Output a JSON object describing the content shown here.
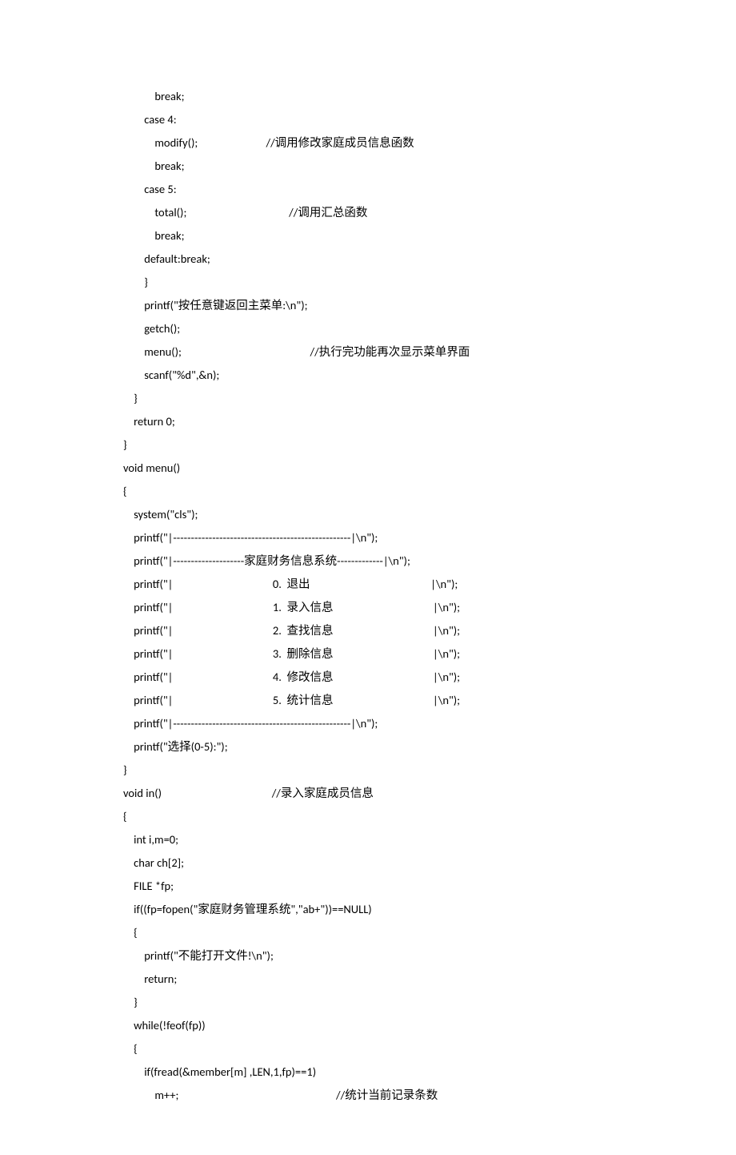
{
  "lines": [
    "            break;",
    "        case 4:",
    "            modify();                          //调用修改家庭成员信息函数",
    "            break;",
    "        case 5:",
    "            total();                                       //调用汇总函数",
    "            break;",
    "        default:break;",
    "        }",
    "        printf(\"按任意键返回主菜单:\\n\");",
    "        getch();",
    "        menu();                                                 //执行完功能再次显示菜单界面",
    "        scanf(\"%d\",&n);",
    "    }",
    "    return 0;",
    "}",
    "void menu()",
    "{",
    "    system(\"cls\");",
    "    printf(\"|--------------------------------------------------|\\n\");",
    "    printf(\"|--------------------家庭财务信息系统-------------|\\n\");",
    "    printf(\"|                                      0.  退出                                              |\\n\");",
    "    printf(\"|                                      1.  录入信息                                      |\\n\");",
    "    printf(\"|                                      2.  查找信息                                      |\\n\");",
    "    printf(\"|                                      3.  删除信息                                      |\\n\");",
    "    printf(\"|                                      4.  修改信息                                      |\\n\");",
    "    printf(\"|                                      5.  统计信息                                      |\\n\");",
    "    printf(\"|--------------------------------------------------|\\n\");",
    "    printf(\"选择(0-5):\");",
    "}",
    "void in()                                          //录入家庭成员信息",
    "{",
    "    int i,m=0;",
    "    char ch[2];",
    "    FILE *fp;",
    "    if((fp=fopen(\"家庭财务管理系统\",\"ab+\"))==NULL)",
    "    {",
    "        printf(\"不能打开文件!\\n\");",
    "        return;",
    "    }",
    "    while(!feof(fp))",
    "    {",
    "        if(fread(&member[m] ,LEN,1,fp)==1)",
    "            m++;                                                            //统计当前记录条数"
  ]
}
